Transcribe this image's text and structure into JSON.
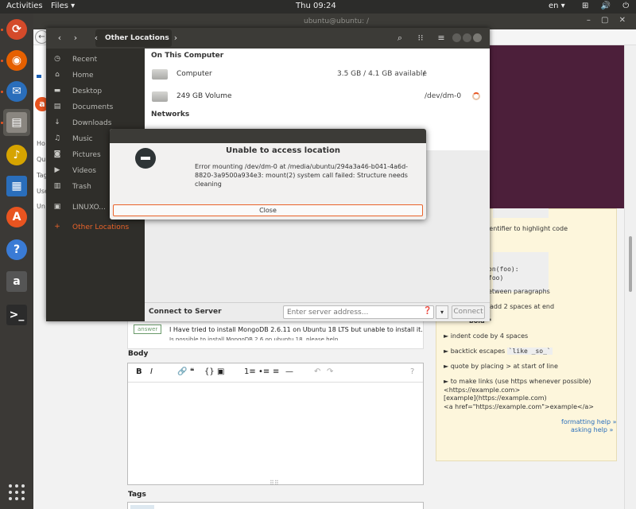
{
  "topbar": {
    "activities": "Activities",
    "app_menu": "Files ▾",
    "clock": "Thu 09:24",
    "language": "en ▾",
    "status_icons": "⊞ 🔊 ⏻ ▾"
  },
  "dock": {
    "items": [
      {
        "name": "software-updater",
        "glyph": "⟳",
        "color": "#d44a2a"
      },
      {
        "name": "firefox",
        "glyph": "◉",
        "color": "#e66000"
      },
      {
        "name": "thunderbird",
        "glyph": "✉",
        "color": "#2a6ebb"
      },
      {
        "name": "files",
        "glyph": "▤",
        "color": "#8a8680"
      },
      {
        "name": "rhythmbox",
        "glyph": "♪",
        "color": "#d6a400"
      },
      {
        "name": "libreoffice-writer",
        "glyph": "▦",
        "color": "#2a6ebb"
      },
      {
        "name": "ubuntu-software",
        "glyph": "A",
        "color": "#e95420"
      },
      {
        "name": "help",
        "glyph": "?",
        "color": "#3a7bd5"
      },
      {
        "name": "amazon",
        "glyph": "a",
        "color": "#555555"
      },
      {
        "name": "terminal",
        "glyph": ">_",
        "color": "#2b2b2b"
      }
    ]
  },
  "browser": {
    "title": "ubuntu@ubuntu: /",
    "nav": [
      "Ho",
      "Qu",
      "Tag",
      "Use",
      "Un"
    ],
    "answer": {
      "badge": "answer",
      "text": "I Have tried to install MongoDB 2.6.11 on Ubuntu 18 LTS but unable to install it.",
      "cut": "Is possible to install MongoDB 2.6 on ubuntu 18, please help"
    },
    "body_label": "Body",
    "tags_label": "Tags",
    "editor_tools": [
      "B",
      "I",
      "🔗",
      "❝",
      "{}",
      "▣",
      "1≡",
      "•≡",
      "≡",
      "—",
      "↶",
      "↷",
      "?"
    ],
    "help": {
      "identifier": "identifier to highlight code",
      "code": "on(foo):\nfoo)",
      "between": "etween paragraphs",
      "add_spaces": "add 2 spaces at end",
      "bold_frag": "bold**",
      "indent": "► indent code by 4 spaces",
      "backtick_pre": "► backtick escapes",
      "backtick_code": "`like _so_`",
      "quote": "► quote by placing > at start of line",
      "links": "► to make links (use https whenever possible)",
      "link1": "<https://example.com>",
      "link2": "[example](https://example.com)",
      "link3": "<a href=\"https://example.com\">example</a>",
      "formatting_help": "formatting help »",
      "asking_help": "asking help »"
    }
  },
  "files": {
    "location": "Other Locations",
    "sidebar": [
      {
        "icon": "◷",
        "label": "Recent"
      },
      {
        "icon": "⌂",
        "label": "Home"
      },
      {
        "icon": "▬",
        "label": "Desktop"
      },
      {
        "icon": "▤",
        "label": "Documents"
      },
      {
        "icon": "↓",
        "label": "Downloads"
      },
      {
        "icon": "♫",
        "label": "Music"
      },
      {
        "icon": "◙",
        "label": "Pictures"
      },
      {
        "icon": "▶",
        "label": "Videos"
      },
      {
        "icon": "▥",
        "label": "Trash"
      },
      {
        "icon": "▣",
        "label": "LINUXO..."
      },
      {
        "icon": "+",
        "label": "Other Locations"
      }
    ],
    "section_this_computer": "On This Computer",
    "section_networks": "Networks",
    "locations": [
      {
        "name": "Computer",
        "usage": "3.5 GB / 4.1 GB available",
        "path": "/"
      },
      {
        "name": "249 GB Volume",
        "usage": "",
        "path": "/dev/dm-0"
      }
    ],
    "connect": {
      "label": "Connect to Server",
      "placeholder": "Enter server address...",
      "help_icon": "❓",
      "dropdown": "▾",
      "button": "Connect"
    }
  },
  "dialog": {
    "title": "Unable to access location",
    "message": "Error mounting /dev/dm-0 at /media/ubuntu/294a3a46-b041-4a6d-8820-3a9500a934e3: mount(2) system call failed: Structure needs cleaning",
    "close": "Close"
  }
}
